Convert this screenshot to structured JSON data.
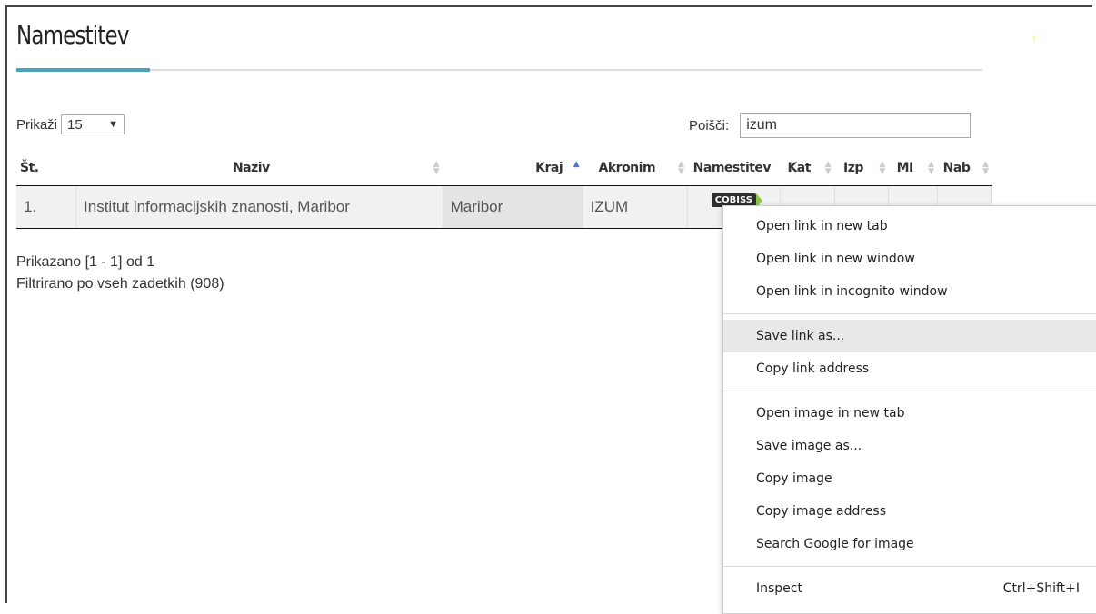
{
  "page": {
    "title": "Namestitev"
  },
  "length_control": {
    "label": "Prikaži",
    "selected": "15"
  },
  "search": {
    "label": "Poišči:",
    "value": "izum"
  },
  "table": {
    "headers": [
      "Št.",
      "Naziv",
      "Kraj",
      "Akronim",
      "Namestitev",
      "Kat",
      "Izp",
      "MI",
      "Nab"
    ],
    "rows": [
      {
        "num": "1.",
        "naziv": "Institut informacijskih znanosti, Maribor",
        "kraj": "Maribor",
        "akronim": "IZUM",
        "badge": "COBISS"
      }
    ]
  },
  "info": {
    "showing": "Prikazano [1 - 1] od 1",
    "filtered": "Filtrirano po vseh zadetkih (908)"
  },
  "context_menu": {
    "items": [
      "Open link in new tab",
      "Open link in new window",
      "Open link in incognito window",
      "Save link as...",
      "Copy link address",
      "Open image in new tab",
      "Save image as...",
      "Copy image",
      "Copy image address",
      "Search Google for image",
      "Inspect"
    ],
    "inspect_shortcut": "Ctrl+Shift+I"
  },
  "colors": {
    "accent": "#4ea4bf",
    "sort_active": "#4a78c8",
    "badge": "#2d2d2d"
  }
}
